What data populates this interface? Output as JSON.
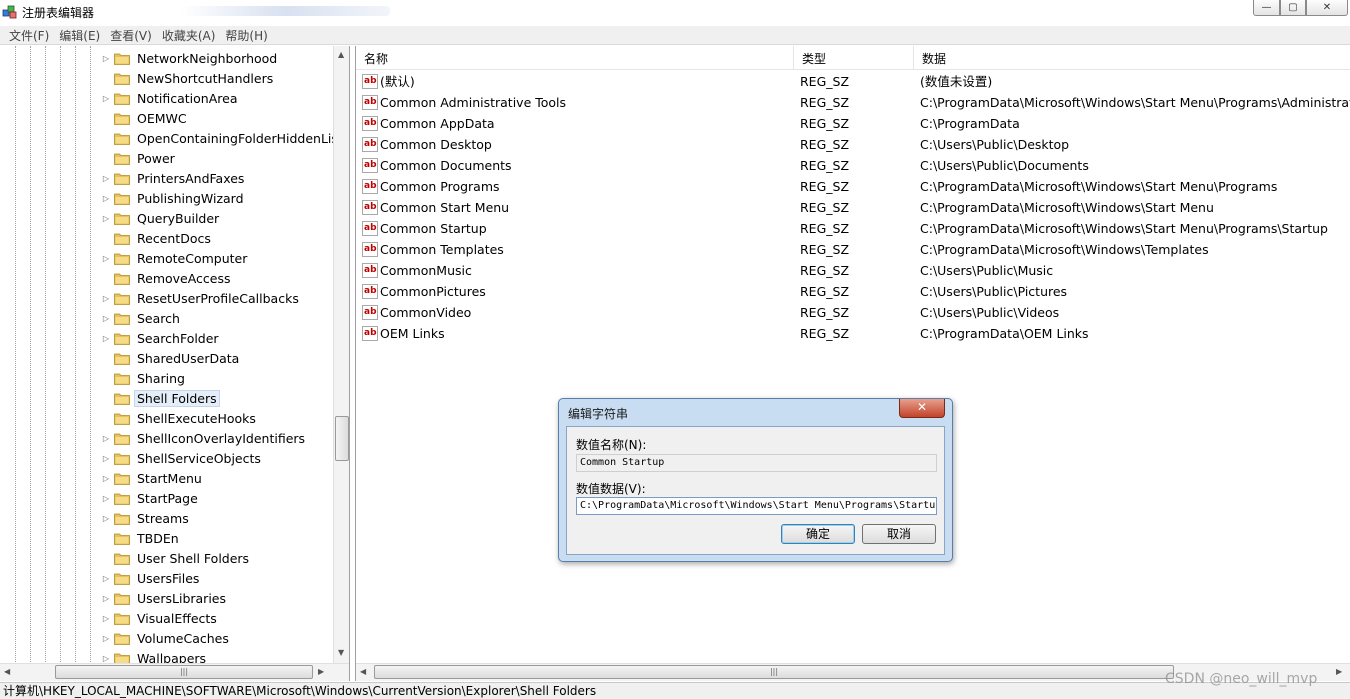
{
  "window": {
    "title": "注册表编辑器",
    "buttons": {
      "minimize": "—",
      "maximize": "▢",
      "close": "✕"
    }
  },
  "menubar": {
    "items": [
      "文件(F)",
      "编辑(E)",
      "查看(V)",
      "收藏夹(A)",
      "帮助(H)"
    ]
  },
  "tree": {
    "items": [
      {
        "label": "NetworkNeighborhood",
        "expandable": true
      },
      {
        "label": "NewShortcutHandlers",
        "expandable": false
      },
      {
        "label": "NotificationArea",
        "expandable": true
      },
      {
        "label": "OEMWC",
        "expandable": false
      },
      {
        "label": "OpenContainingFolderHiddenList",
        "expandable": false
      },
      {
        "label": "Power",
        "expandable": false
      },
      {
        "label": "PrintersAndFaxes",
        "expandable": true
      },
      {
        "label": "PublishingWizard",
        "expandable": true
      },
      {
        "label": "QueryBuilder",
        "expandable": true
      },
      {
        "label": "RecentDocs",
        "expandable": false
      },
      {
        "label": "RemoteComputer",
        "expandable": true
      },
      {
        "label": "RemoveAccess",
        "expandable": false
      },
      {
        "label": "ResetUserProfileCallbacks",
        "expandable": true
      },
      {
        "label": "Search",
        "expandable": true
      },
      {
        "label": "SearchFolder",
        "expandable": true
      },
      {
        "label": "SharedUserData",
        "expandable": false
      },
      {
        "label": "Sharing",
        "expandable": false
      },
      {
        "label": "Shell Folders",
        "expandable": false,
        "selected": true
      },
      {
        "label": "ShellExecuteHooks",
        "expandable": false
      },
      {
        "label": "ShellIconOverlayIdentifiers",
        "expandable": true
      },
      {
        "label": "ShellServiceObjects",
        "expandable": true
      },
      {
        "label": "StartMenu",
        "expandable": true
      },
      {
        "label": "StartPage",
        "expandable": true
      },
      {
        "label": "Streams",
        "expandable": true
      },
      {
        "label": "TBDEn",
        "expandable": false
      },
      {
        "label": "User Shell Folders",
        "expandable": false
      },
      {
        "label": "UsersFiles",
        "expandable": true
      },
      {
        "label": "UsersLibraries",
        "expandable": true
      },
      {
        "label": "VisualEffects",
        "expandable": true
      },
      {
        "label": "VolumeCaches",
        "expandable": true
      },
      {
        "label": "Wallpapers",
        "expandable": true
      }
    ]
  },
  "list": {
    "columns": [
      "名称",
      "类型",
      "数据"
    ],
    "rows": [
      {
        "name": "(默认)",
        "type": "REG_SZ",
        "data": "(数值未设置)"
      },
      {
        "name": "Common Administrative Tools",
        "type": "REG_SZ",
        "data": "C:\\ProgramData\\Microsoft\\Windows\\Start Menu\\Programs\\Administrative"
      },
      {
        "name": "Common AppData",
        "type": "REG_SZ",
        "data": "C:\\ProgramData"
      },
      {
        "name": "Common Desktop",
        "type": "REG_SZ",
        "data": "C:\\Users\\Public\\Desktop"
      },
      {
        "name": "Common Documents",
        "type": "REG_SZ",
        "data": "C:\\Users\\Public\\Documents"
      },
      {
        "name": "Common Programs",
        "type": "REG_SZ",
        "data": "C:\\ProgramData\\Microsoft\\Windows\\Start Menu\\Programs"
      },
      {
        "name": "Common Start Menu",
        "type": "REG_SZ",
        "data": "C:\\ProgramData\\Microsoft\\Windows\\Start Menu"
      },
      {
        "name": "Common Startup",
        "type": "REG_SZ",
        "data": "C:\\ProgramData\\Microsoft\\Windows\\Start Menu\\Programs\\Startup"
      },
      {
        "name": "Common Templates",
        "type": "REG_SZ",
        "data": "C:\\ProgramData\\Microsoft\\Windows\\Templates"
      },
      {
        "name": "CommonMusic",
        "type": "REG_SZ",
        "data": "C:\\Users\\Public\\Music"
      },
      {
        "name": "CommonPictures",
        "type": "REG_SZ",
        "data": "C:\\Users\\Public\\Pictures"
      },
      {
        "name": "CommonVideo",
        "type": "REG_SZ",
        "data": "C:\\Users\\Public\\Videos"
      },
      {
        "name": "OEM Links",
        "type": "REG_SZ",
        "data": "C:\\ProgramData\\OEM Links"
      }
    ]
  },
  "dialog": {
    "title": "编辑字符串",
    "close_label": "✕",
    "name_label": "数值名称(N):",
    "name_value": "Common Startup",
    "data_label": "数值数据(V):",
    "data_value": "C:\\ProgramData\\Microsoft\\Windows\\Start Menu\\Programs\\Startu",
    "ok_label": "确定",
    "cancel_label": "取消"
  },
  "status": {
    "path": "计算机\\HKEY_LOCAL_MACHINE\\SOFTWARE\\Microsoft\\Windows\\CurrentVersion\\Explorer\\Shell Folders"
  },
  "watermark": "CSDN @neo_will_mvp",
  "icons": {
    "app": "registry-editor-icon",
    "folder": "folder-icon",
    "string_value": "ab-string-icon",
    "expander": "triangle-right-icon"
  },
  "colors": {
    "folder": "#e8c15a",
    "selection": "#e5eef8",
    "dialog_frame": "#c8dcf2",
    "close_red": "#c2432a"
  }
}
